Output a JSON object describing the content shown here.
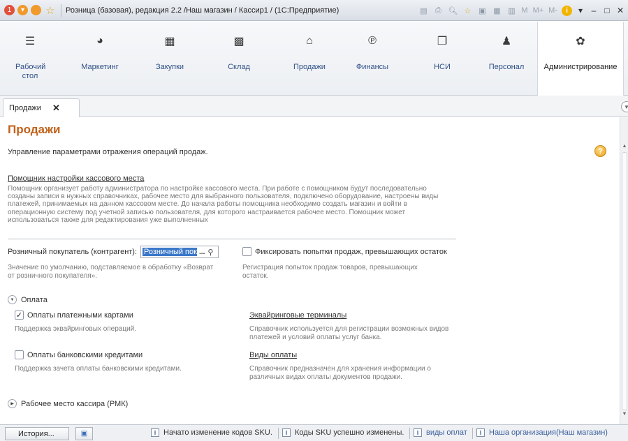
{
  "window": {
    "title": "Розница (базовая), редакция 2.2 /Наш магазин / Кассир1 / (1С:Предприятие)",
    "toolbar_m_labels": [
      "M",
      "M+",
      "M-"
    ]
  },
  "sections": [
    {
      "label": "Рабочий стол",
      "icon": "desktop-icon"
    },
    {
      "label": "Маркетинг",
      "icon": "marketing-icon"
    },
    {
      "label": "Закупки",
      "icon": "purchases-icon"
    },
    {
      "label": "Склад",
      "icon": "warehouse-icon"
    },
    {
      "label": "Продажи",
      "icon": "sales-icon"
    },
    {
      "label": "Финансы",
      "icon": "finance-icon"
    },
    {
      "label": "НСИ",
      "icon": "reference-icon"
    },
    {
      "label": "Персонал",
      "icon": "personnel-icon"
    },
    {
      "label": "Администрирование",
      "icon": "gear-icon",
      "active": true
    }
  ],
  "tabs": [
    {
      "label": "Продажи"
    }
  ],
  "page": {
    "title": "Продажи",
    "description": "Управление параметрами отражения операций продаж.",
    "assistant_link": "Помощник настройки кассового места",
    "assistant_text": "Помощник организует работу администратора по настройке кассового места. При работе с помощником будут последовательно созданы записи в нужных справочниках, рабочее место для выбранного пользователя, подключено оборудование, настроены виды платежей, принимаемых на данном кассовом месте. До начала работы помощника необходимо создать магазин и войти в операционную систему под учетной записью пользователя, для которого настраивается рабочее место. Помощник может использоваться также для редактирования уже выполненных",
    "customer_label": "Розничный покупатель (контрагент):",
    "customer_value": "Розничный пок",
    "customer_hint": "Значение по умолчанию, подставляемое в обработку «Возврат от розничного покупателя».",
    "fix_attempts_label": "Фиксировать попытки продаж, превышающих остаток",
    "fix_attempts_checked": false,
    "fix_attempts_hint": "Регистрация попыток продаж товаров, превышающих остаток.",
    "payment_group": "Оплата",
    "card_payments_label": "Оплаты платежными картами",
    "card_payments_checked": true,
    "card_payments_hint": "Поддержка эквайринговых операций.",
    "acquiring_link": "Эквайринговые терминалы",
    "acquiring_hint": "Справочник используется для регистрации возможных видов платежей и условий оплаты услуг банка.",
    "bank_credit_label": "Оплаты банковскими кредитами",
    "bank_credit_checked": false,
    "bank_credit_hint": "Поддержка зачета оплаты банковскими кредитами.",
    "payment_types_link": "Виды оплаты",
    "payment_types_hint": "Справочник предназначен для хранения информации о различных видах оплаты документов продажи.",
    "cashier_group": "Рабочее место кассира (РМК)"
  },
  "statusbar": {
    "history": "История...",
    "notifications": [
      {
        "text": "Начато изменение кодов SKU.",
        "blue": false
      },
      {
        "text": "Коды SKU успешно изменены.",
        "blue": false
      },
      {
        "text": "виды оплат",
        "blue": true
      },
      {
        "text": "Наша организация(Наш магазин)",
        "blue": true
      }
    ]
  },
  "colors": {
    "title_orange": "#c2611a",
    "link_blue": "#2f4f85",
    "selection_blue": "#3b78c9"
  }
}
